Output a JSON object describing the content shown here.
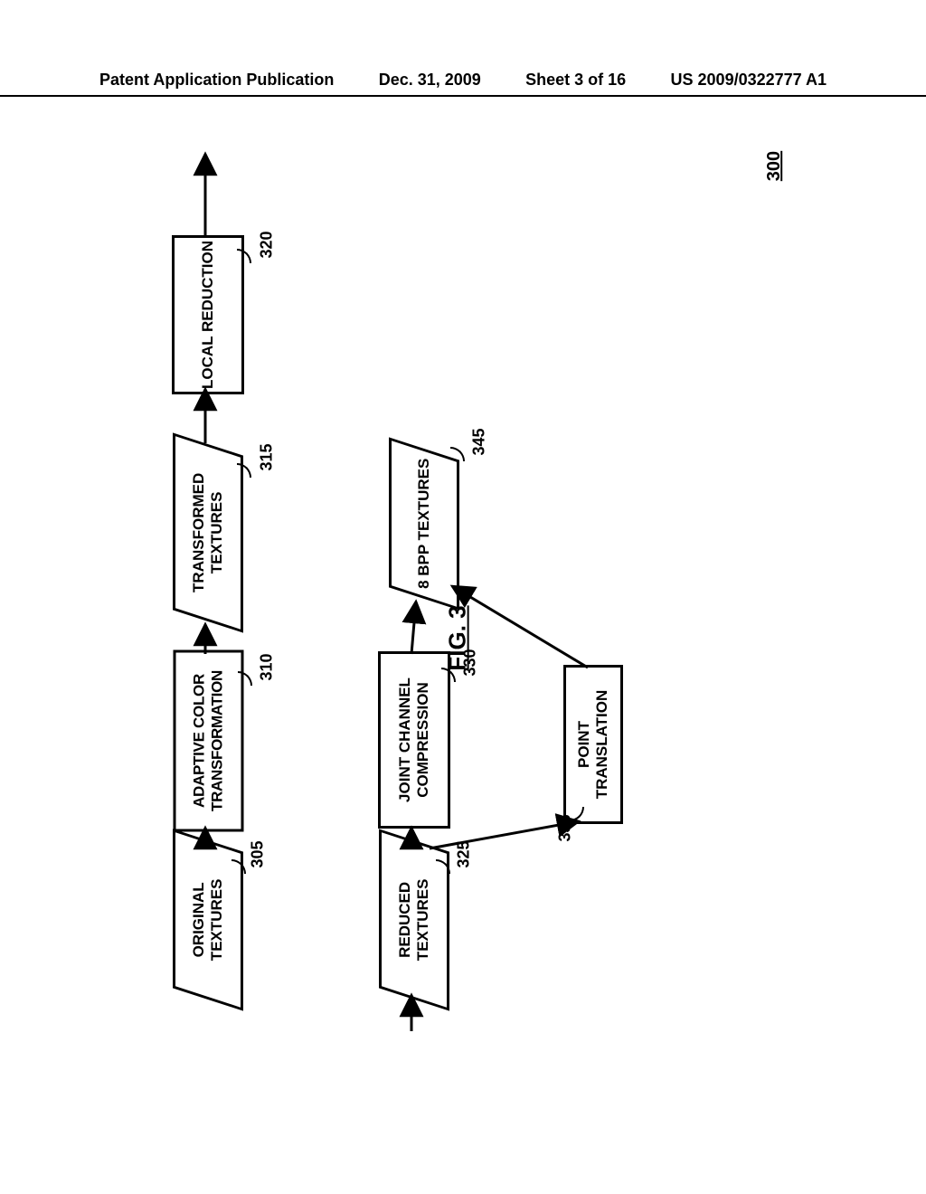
{
  "header": {
    "pub_type": "Patent Application Publication",
    "date": "Dec. 31, 2009",
    "sheet": "Sheet 3 of 16",
    "pub_no": "US 2009/0322777 A1"
  },
  "diagram": {
    "number": "300",
    "figure_caption": "FIG. 3",
    "nodes": {
      "n305": {
        "ref": "305",
        "text": "ORIGINAL TEXTURES"
      },
      "n310": {
        "ref": "310",
        "text": "ADAPTIVE COLOR TRANSFORMATION"
      },
      "n315": {
        "ref": "315",
        "text": "TRANSFORMED TEXTURES"
      },
      "n320": {
        "ref": "320",
        "text": "LOCAL REDUCTION"
      },
      "n325": {
        "ref": "325",
        "text": "REDUCED TEXTURES"
      },
      "n330": {
        "ref": "330",
        "text": "JOINT CHANNEL COMPRESSION"
      },
      "n335": {
        "ref": "335",
        "text": "POINT TRANSLATION"
      },
      "n345": {
        "ref": "345",
        "text": "8 BPP TEXTURES"
      }
    }
  },
  "chart_data": {
    "type": "diagram",
    "title": "FIG. 3",
    "diagram_ref": "300",
    "nodes": [
      {
        "id": "305",
        "label": "ORIGINAL TEXTURES",
        "shape": "parallelogram"
      },
      {
        "id": "310",
        "label": "ADAPTIVE COLOR TRANSFORMATION",
        "shape": "rect"
      },
      {
        "id": "315",
        "label": "TRANSFORMED TEXTURES",
        "shape": "parallelogram"
      },
      {
        "id": "320",
        "label": "LOCAL REDUCTION",
        "shape": "rect"
      },
      {
        "id": "325",
        "label": "REDUCED TEXTURES",
        "shape": "parallelogram"
      },
      {
        "id": "330",
        "label": "JOINT CHANNEL COMPRESSION",
        "shape": "rect"
      },
      {
        "id": "335",
        "label": "POINT TRANSLATION",
        "shape": "rect"
      },
      {
        "id": "345",
        "label": "8 BPP TEXTURES",
        "shape": "parallelogram"
      }
    ],
    "edges": [
      {
        "from": "305",
        "to": "310"
      },
      {
        "from": "310",
        "to": "315"
      },
      {
        "from": "315",
        "to": "320"
      },
      {
        "from": "320",
        "to": "325",
        "note": "wraps to second row"
      },
      {
        "from": "325",
        "to": "330"
      },
      {
        "from": "325",
        "to": "335"
      },
      {
        "from": "330",
        "to": "345"
      },
      {
        "from": "335",
        "to": "345"
      }
    ]
  }
}
